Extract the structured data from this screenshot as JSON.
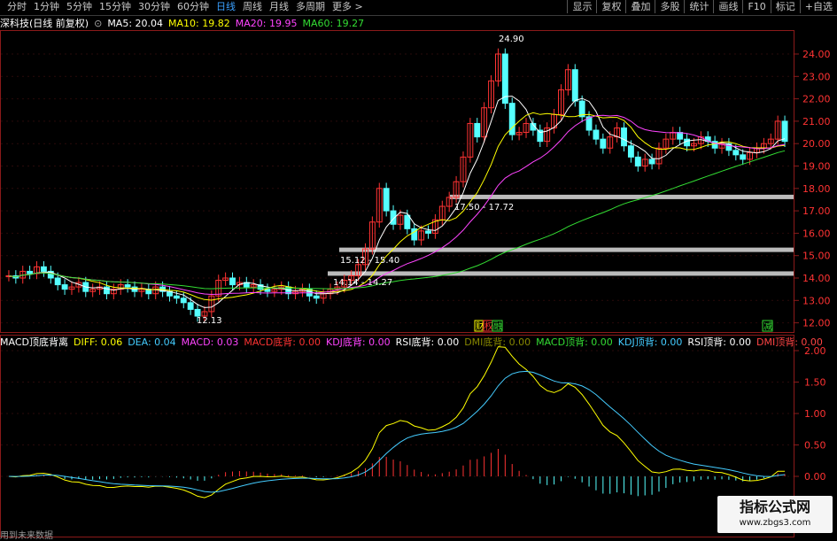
{
  "toolbar": {
    "periods": [
      "分时",
      "1分钟",
      "5分钟",
      "15分钟",
      "30分钟",
      "60分钟",
      "日线",
      "周线",
      "月线",
      "多周期",
      "更多 >"
    ],
    "active_period": "日线",
    "right_buttons": [
      "显示",
      "复权",
      "叠加",
      "多股",
      "统计",
      "画线",
      "F10",
      "标记",
      "+自选"
    ]
  },
  "price_panel": {
    "title": "深科技(日线 前复权)",
    "ma": [
      {
        "label": "MA5: 20.04",
        "color": "#ffffff"
      },
      {
        "label": "MA10: 19.82",
        "color": "#ffff00"
      },
      {
        "label": "MA20: 19.95",
        "color": "#ff44ff"
      },
      {
        "label": "MA60: 19.27",
        "color": "#33dd33"
      }
    ],
    "y_ticks": [
      "24.00",
      "23.00",
      "22.00",
      "21.00",
      "20.00",
      "19.00",
      "18.00",
      "17.00",
      "16.00",
      "15.00",
      "14.00",
      "13.00",
      "12.00"
    ],
    "annotations": {
      "high": "24.90",
      "low": "12.13",
      "zone1": "17.50 - 17.72",
      "zone2": "15.12 - 15.40",
      "zone3": "14.14 - 14.27"
    },
    "event_labels": {
      "e1": "财",
      "e2": "权",
      "e3": "融",
      "e4": "减"
    }
  },
  "macd_panel": {
    "title": "MACD顶底背离",
    "items": [
      {
        "label": "DIFF: 0.06",
        "color": "#ffff00"
      },
      {
        "label": "DEA: 0.04",
        "color": "#44ccff"
      },
      {
        "label": "MACD: 0.03",
        "color": "#ff44ff"
      },
      {
        "label": "MACD底背: 0.00",
        "color": "#ff3333"
      },
      {
        "label": "KDJ底背: 0.00",
        "color": "#ff44ff"
      },
      {
        "label": "RSI底背: 0.00",
        "color": "#ffffff"
      },
      {
        "label": "DMI底背: 0.00",
        "color": "#888800"
      },
      {
        "label": "MACD顶背: 0.00",
        "color": "#33dd33"
      },
      {
        "label": "KDJ顶背: 0.00",
        "color": "#44ccff"
      },
      {
        "label": "RSI顶背: 0.00",
        "color": "#ffffff"
      },
      {
        "label": "DMI顶背: 0.00",
        "color": "#ff4444"
      }
    ],
    "y_ticks": [
      "2.00",
      "1.50",
      "1.00",
      "0.50",
      "0.00"
    ]
  },
  "watermark": {
    "title": "指标公式网",
    "url": "www.zbgs3.com"
  },
  "bottom_note": "用到未来数据"
}
